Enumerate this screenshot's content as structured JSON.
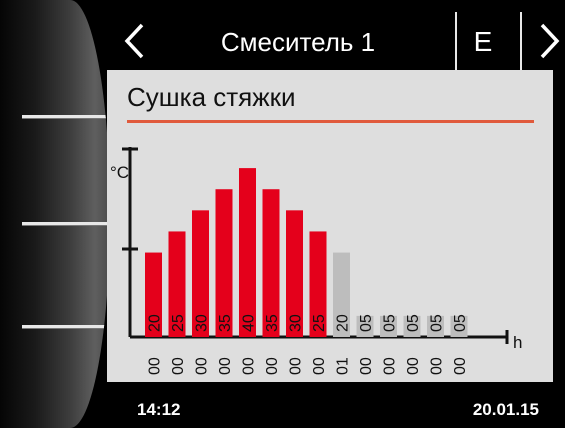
{
  "nav": {
    "title": "Смеситель 1",
    "mode_label": "E"
  },
  "screen": {
    "title": "Сушка стяжки"
  },
  "chart_data": {
    "type": "bar",
    "ylabel": "°C",
    "xlabel": "h",
    "categories": [
      "00",
      "00",
      "00",
      "00",
      "00",
      "00",
      "00",
      "00",
      "01",
      "00",
      "00",
      "00",
      "00",
      "00"
    ],
    "values": [
      20,
      25,
      30,
      35,
      40,
      35,
      30,
      25,
      20,
      5,
      5,
      5,
      5,
      5
    ],
    "bar_labels": [
      "20",
      "25",
      "30",
      "35",
      "40",
      "35",
      "30",
      "25",
      "20",
      "05",
      "05",
      "05",
      "05",
      "05"
    ],
    "active_bars": 8,
    "ylim": [
      0,
      45
    ],
    "colors": {
      "active": "#e4001b",
      "inactive": "#bdbdbd",
      "accent_line": "#e05a3c"
    }
  },
  "status": {
    "time": "14:12",
    "date": "20.01.15"
  }
}
